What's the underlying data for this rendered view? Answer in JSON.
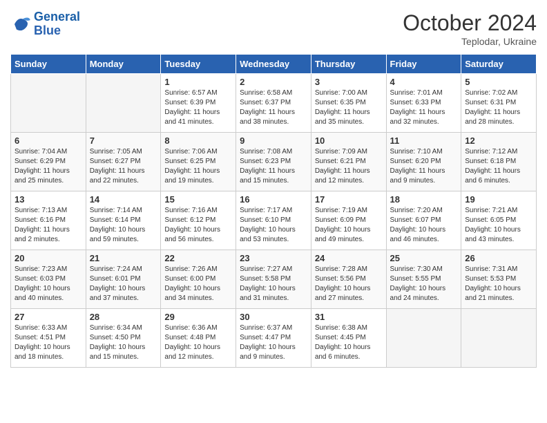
{
  "header": {
    "logo_general": "General",
    "logo_blue": "Blue",
    "month_year": "October 2024",
    "location": "Teplodar, Ukraine"
  },
  "days_of_week": [
    "Sunday",
    "Monday",
    "Tuesday",
    "Wednesday",
    "Thursday",
    "Friday",
    "Saturday"
  ],
  "weeks": [
    [
      {
        "day": "",
        "sunrise": "",
        "sunset": "",
        "daylight": ""
      },
      {
        "day": "",
        "sunrise": "",
        "sunset": "",
        "daylight": ""
      },
      {
        "day": "1",
        "sunrise": "Sunrise: 6:57 AM",
        "sunset": "Sunset: 6:39 PM",
        "daylight": "Daylight: 11 hours and 41 minutes."
      },
      {
        "day": "2",
        "sunrise": "Sunrise: 6:58 AM",
        "sunset": "Sunset: 6:37 PM",
        "daylight": "Daylight: 11 hours and 38 minutes."
      },
      {
        "day": "3",
        "sunrise": "Sunrise: 7:00 AM",
        "sunset": "Sunset: 6:35 PM",
        "daylight": "Daylight: 11 hours and 35 minutes."
      },
      {
        "day": "4",
        "sunrise": "Sunrise: 7:01 AM",
        "sunset": "Sunset: 6:33 PM",
        "daylight": "Daylight: 11 hours and 32 minutes."
      },
      {
        "day": "5",
        "sunrise": "Sunrise: 7:02 AM",
        "sunset": "Sunset: 6:31 PM",
        "daylight": "Daylight: 11 hours and 28 minutes."
      }
    ],
    [
      {
        "day": "6",
        "sunrise": "Sunrise: 7:04 AM",
        "sunset": "Sunset: 6:29 PM",
        "daylight": "Daylight: 11 hours and 25 minutes."
      },
      {
        "day": "7",
        "sunrise": "Sunrise: 7:05 AM",
        "sunset": "Sunset: 6:27 PM",
        "daylight": "Daylight: 11 hours and 22 minutes."
      },
      {
        "day": "8",
        "sunrise": "Sunrise: 7:06 AM",
        "sunset": "Sunset: 6:25 PM",
        "daylight": "Daylight: 11 hours and 19 minutes."
      },
      {
        "day": "9",
        "sunrise": "Sunrise: 7:08 AM",
        "sunset": "Sunset: 6:23 PM",
        "daylight": "Daylight: 11 hours and 15 minutes."
      },
      {
        "day": "10",
        "sunrise": "Sunrise: 7:09 AM",
        "sunset": "Sunset: 6:21 PM",
        "daylight": "Daylight: 11 hours and 12 minutes."
      },
      {
        "day": "11",
        "sunrise": "Sunrise: 7:10 AM",
        "sunset": "Sunset: 6:20 PM",
        "daylight": "Daylight: 11 hours and 9 minutes."
      },
      {
        "day": "12",
        "sunrise": "Sunrise: 7:12 AM",
        "sunset": "Sunset: 6:18 PM",
        "daylight": "Daylight: 11 hours and 6 minutes."
      }
    ],
    [
      {
        "day": "13",
        "sunrise": "Sunrise: 7:13 AM",
        "sunset": "Sunset: 6:16 PM",
        "daylight": "Daylight: 11 hours and 2 minutes."
      },
      {
        "day": "14",
        "sunrise": "Sunrise: 7:14 AM",
        "sunset": "Sunset: 6:14 PM",
        "daylight": "Daylight: 10 hours and 59 minutes."
      },
      {
        "day": "15",
        "sunrise": "Sunrise: 7:16 AM",
        "sunset": "Sunset: 6:12 PM",
        "daylight": "Daylight: 10 hours and 56 minutes."
      },
      {
        "day": "16",
        "sunrise": "Sunrise: 7:17 AM",
        "sunset": "Sunset: 6:10 PM",
        "daylight": "Daylight: 10 hours and 53 minutes."
      },
      {
        "day": "17",
        "sunrise": "Sunrise: 7:19 AM",
        "sunset": "Sunset: 6:09 PM",
        "daylight": "Daylight: 10 hours and 49 minutes."
      },
      {
        "day": "18",
        "sunrise": "Sunrise: 7:20 AM",
        "sunset": "Sunset: 6:07 PM",
        "daylight": "Daylight: 10 hours and 46 minutes."
      },
      {
        "day": "19",
        "sunrise": "Sunrise: 7:21 AM",
        "sunset": "Sunset: 6:05 PM",
        "daylight": "Daylight: 10 hours and 43 minutes."
      }
    ],
    [
      {
        "day": "20",
        "sunrise": "Sunrise: 7:23 AM",
        "sunset": "Sunset: 6:03 PM",
        "daylight": "Daylight: 10 hours and 40 minutes."
      },
      {
        "day": "21",
        "sunrise": "Sunrise: 7:24 AM",
        "sunset": "Sunset: 6:01 PM",
        "daylight": "Daylight: 10 hours and 37 minutes."
      },
      {
        "day": "22",
        "sunrise": "Sunrise: 7:26 AM",
        "sunset": "Sunset: 6:00 PM",
        "daylight": "Daylight: 10 hours and 34 minutes."
      },
      {
        "day": "23",
        "sunrise": "Sunrise: 7:27 AM",
        "sunset": "Sunset: 5:58 PM",
        "daylight": "Daylight: 10 hours and 31 minutes."
      },
      {
        "day": "24",
        "sunrise": "Sunrise: 7:28 AM",
        "sunset": "Sunset: 5:56 PM",
        "daylight": "Daylight: 10 hours and 27 minutes."
      },
      {
        "day": "25",
        "sunrise": "Sunrise: 7:30 AM",
        "sunset": "Sunset: 5:55 PM",
        "daylight": "Daylight: 10 hours and 24 minutes."
      },
      {
        "day": "26",
        "sunrise": "Sunrise: 7:31 AM",
        "sunset": "Sunset: 5:53 PM",
        "daylight": "Daylight: 10 hours and 21 minutes."
      }
    ],
    [
      {
        "day": "27",
        "sunrise": "Sunrise: 6:33 AM",
        "sunset": "Sunset: 4:51 PM",
        "daylight": "Daylight: 10 hours and 18 minutes."
      },
      {
        "day": "28",
        "sunrise": "Sunrise: 6:34 AM",
        "sunset": "Sunset: 4:50 PM",
        "daylight": "Daylight: 10 hours and 15 minutes."
      },
      {
        "day": "29",
        "sunrise": "Sunrise: 6:36 AM",
        "sunset": "Sunset: 4:48 PM",
        "daylight": "Daylight: 10 hours and 12 minutes."
      },
      {
        "day": "30",
        "sunrise": "Sunrise: 6:37 AM",
        "sunset": "Sunset: 4:47 PM",
        "daylight": "Daylight: 10 hours and 9 minutes."
      },
      {
        "day": "31",
        "sunrise": "Sunrise: 6:38 AM",
        "sunset": "Sunset: 4:45 PM",
        "daylight": "Daylight: 10 hours and 6 minutes."
      },
      {
        "day": "",
        "sunrise": "",
        "sunset": "",
        "daylight": ""
      },
      {
        "day": "",
        "sunrise": "",
        "sunset": "",
        "daylight": ""
      }
    ]
  ]
}
